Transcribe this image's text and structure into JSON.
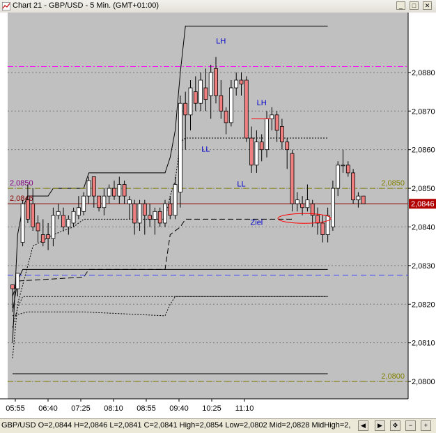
{
  "window": {
    "title": "Chart 21 - GBP/USD - 5 Min. (GMT+01:00)",
    "buttons": [
      "minimize",
      "maximize",
      "close"
    ]
  },
  "status": {
    "text": "GBP/USD O=2,0844 H=2,0846 L=2,0841 C=2,0841   High=2,0854 Low=2,0802 Mid=2,0828 MidHigh=2,"
  },
  "chart_data": {
    "type": "candlestick",
    "instrument": "GBP/USD",
    "timeframe": "5 Min.",
    "ylim": [
      2.07955,
      2.08955
    ],
    "yticks": [
      "2,0880",
      "2,0870",
      "2,0860",
      "2,0850",
      "2,0840",
      "2,0830",
      "2,0820",
      "2,0810",
      "2,0800"
    ],
    "xticks": [
      "05:55",
      "06:40",
      "07:25",
      "08:10",
      "08:55",
      "09:40",
      "10:25",
      "11:10"
    ],
    "candles": [
      {
        "o": 2.0825,
        "h": 2.0822,
        "l": 2.0819,
        "c": 2.0824
      },
      {
        "o": 2.0824,
        "h": 2.0828,
        "l": 2.0822,
        "c": 2.0828
      },
      {
        "o": 2.0836,
        "h": 2.0847,
        "l": 2.0835,
        "c": 2.0846
      },
      {
        "o": 2.0847,
        "h": 2.0851,
        "l": 2.0841,
        "c": 2.0842
      },
      {
        "o": 2.0846,
        "h": 2.085,
        "l": 2.0839,
        "c": 2.084
      },
      {
        "o": 2.0841,
        "h": 2.0843,
        "l": 2.0836,
        "c": 2.0839
      },
      {
        "o": 2.0838,
        "h": 2.0842,
        "l": 2.0835,
        "c": 2.0836
      },
      {
        "o": 2.0838,
        "h": 2.0841,
        "l": 2.0834,
        "c": 2.0837
      },
      {
        "o": 2.0837,
        "h": 2.0845,
        "l": 2.0835,
        "c": 2.0843
      },
      {
        "o": 2.0843,
        "h": 2.0846,
        "l": 2.0842,
        "c": 2.0844
      },
      {
        "o": 2.0843,
        "h": 2.0845,
        "l": 2.0839,
        "c": 2.084
      },
      {
        "o": 2.084,
        "h": 2.0843,
        "l": 2.0838,
        "c": 2.0842
      },
      {
        "o": 2.0841,
        "h": 2.0845,
        "l": 2.084,
        "c": 2.0844
      },
      {
        "o": 2.0843,
        "h": 2.0848,
        "l": 2.0842,
        "c": 2.0845
      },
      {
        "o": 2.0844,
        "h": 2.0849,
        "l": 2.0843,
        "c": 2.0848
      },
      {
        "o": 2.0848,
        "h": 2.0853,
        "l": 2.0846,
        "c": 2.0852
      },
      {
        "o": 2.0853,
        "h": 2.0853,
        "l": 2.0845,
        "c": 2.0848
      },
      {
        "o": 2.0848,
        "h": 2.0848,
        "l": 2.0844,
        "c": 2.0845
      },
      {
        "o": 2.0845,
        "h": 2.085,
        "l": 2.0843,
        "c": 2.0848
      },
      {
        "o": 2.0848,
        "h": 2.0851,
        "l": 2.0846,
        "c": 2.085
      },
      {
        "o": 2.085,
        "h": 2.0852,
        "l": 2.0847,
        "c": 2.0848
      },
      {
        "o": 2.0848,
        "h": 2.0853,
        "l": 2.0846,
        "c": 2.0851
      },
      {
        "o": 2.0851,
        "h": 2.0852,
        "l": 2.0846,
        "c": 2.0848
      },
      {
        "o": 2.0846,
        "h": 2.0848,
        "l": 2.0842,
        "c": 2.0847
      },
      {
        "o": 2.0846,
        "h": 2.0847,
        "l": 2.0838,
        "c": 2.0841
      },
      {
        "o": 2.0841,
        "h": 2.0847,
        "l": 2.0839,
        "c": 2.0846
      },
      {
        "o": 2.0846,
        "h": 2.0847,
        "l": 2.0838,
        "c": 2.0843
      },
      {
        "o": 2.0843,
        "h": 2.0846,
        "l": 2.084,
        "c": 2.0842
      },
      {
        "o": 2.0842,
        "h": 2.0845,
        "l": 2.0838,
        "c": 2.0844
      },
      {
        "o": 2.0844,
        "h": 2.0845,
        "l": 2.084,
        "c": 2.0841
      },
      {
        "o": 2.0841,
        "h": 2.0847,
        "l": 2.084,
        "c": 2.0846
      },
      {
        "o": 2.0846,
        "h": 2.0848,
        "l": 2.0842,
        "c": 2.0843
      },
      {
        "o": 2.0843,
        "h": 2.0853,
        "l": 2.0842,
        "c": 2.0851
      },
      {
        "o": 2.0849,
        "h": 2.0874,
        "l": 2.0845,
        "c": 2.0872
      },
      {
        "o": 2.0872,
        "h": 2.0875,
        "l": 2.086,
        "c": 2.0869
      },
      {
        "o": 2.0869,
        "h": 2.0878,
        "l": 2.0865,
        "c": 2.0876
      },
      {
        "o": 2.0875,
        "h": 2.0879,
        "l": 2.087,
        "c": 2.0872
      },
      {
        "o": 2.0872,
        "h": 2.088,
        "l": 2.087,
        "c": 2.0878
      },
      {
        "o": 2.0876,
        "h": 2.0881,
        "l": 2.087,
        "c": 2.0873
      },
      {
        "o": 2.0874,
        "h": 2.0882,
        "l": 2.0868,
        "c": 2.088
      },
      {
        "o": 2.0881,
        "h": 2.0884,
        "l": 2.0872,
        "c": 2.0874
      },
      {
        "o": 2.0874,
        "h": 2.0878,
        "l": 2.0868,
        "c": 2.087
      },
      {
        "o": 2.087,
        "h": 2.0871,
        "l": 2.0864,
        "c": 2.0867
      },
      {
        "o": 2.0867,
        "h": 2.0878,
        "l": 2.0866,
        "c": 2.0876
      },
      {
        "o": 2.0876,
        "h": 2.088,
        "l": 2.0874,
        "c": 2.0878
      },
      {
        "o": 2.0878,
        "h": 2.088,
        "l": 2.0874,
        "c": 2.0877
      },
      {
        "o": 2.0878,
        "h": 2.0879,
        "l": 2.0862,
        "c": 2.0863
      },
      {
        "o": 2.0863,
        "h": 2.0866,
        "l": 2.0854,
        "c": 2.0856
      },
      {
        "o": 2.0856,
        "h": 2.0865,
        "l": 2.0854,
        "c": 2.0862
      },
      {
        "o": 2.0862,
        "h": 2.0864,
        "l": 2.0857,
        "c": 2.086
      },
      {
        "o": 2.086,
        "h": 2.087,
        "l": 2.0858,
        "c": 2.0868
      },
      {
        "o": 2.0868,
        "h": 2.0871,
        "l": 2.0865,
        "c": 2.0869
      },
      {
        "o": 2.0869,
        "h": 2.087,
        "l": 2.0862,
        "c": 2.0865
      },
      {
        "o": 2.0866,
        "h": 2.0868,
        "l": 2.086,
        "c": 2.0862
      },
      {
        "o": 2.0862,
        "h": 2.0863,
        "l": 2.0855,
        "c": 2.086
      },
      {
        "o": 2.0859,
        "h": 2.086,
        "l": 2.0844,
        "c": 2.0846
      },
      {
        "o": 2.0846,
        "h": 2.0849,
        "l": 2.0844,
        "c": 2.0847
      },
      {
        "o": 2.0846,
        "h": 2.0848,
        "l": 2.0843,
        "c": 2.0845
      },
      {
        "o": 2.0845,
        "h": 2.0851,
        "l": 2.0844,
        "c": 2.0847
      },
      {
        "o": 2.0846,
        "h": 2.0847,
        "l": 2.084,
        "c": 2.0843
      },
      {
        "o": 2.0843,
        "h": 2.0845,
        "l": 2.0838,
        "c": 2.0841
      },
      {
        "o": 2.0841,
        "h": 2.0843,
        "l": 2.0836,
        "c": 2.0838
      },
      {
        "o": 2.0838,
        "h": 2.0845,
        "l": 2.0836,
        "c": 2.0843
      },
      {
        "o": 2.084,
        "h": 2.0852,
        "l": 2.0839,
        "c": 2.085
      },
      {
        "o": 2.085,
        "h": 2.0857,
        "l": 2.0848,
        "c": 2.0856
      },
      {
        "o": 2.0856,
        "h": 2.086,
        "l": 2.0854,
        "c": 2.0856
      },
      {
        "o": 2.0856,
        "h": 2.0857,
        "l": 2.0853,
        "c": 2.0854
      },
      {
        "o": 2.0854,
        "h": 2.0855,
        "l": 2.0846,
        "c": 2.0847
      },
      {
        "o": 2.0847,
        "h": 2.0849,
        "l": 2.0845,
        "c": 2.0848
      },
      {
        "o": 2.0848,
        "h": 2.0848,
        "l": 2.0846,
        "c": 2.0846
      }
    ],
    "levels": [
      {
        "kind": "hline",
        "value": 2.08815,
        "color": "#ff00ff",
        "style": "dashdot"
      },
      {
        "kind": "hline",
        "value": 2.08275,
        "color": "#4040ff",
        "style": "dashed"
      },
      {
        "kind": "hline",
        "value": 2.085,
        "color": "#808000",
        "style": "dashed",
        "label_left": "2,0850",
        "label_right": "2,0850"
      },
      {
        "kind": "hline",
        "value": 2.08,
        "color": "#808000",
        "style": "dashed",
        "label_right": "2,0800"
      },
      {
        "kind": "hline",
        "value": 2.0846,
        "color": "#8b0000",
        "style": "solid",
        "label_left": "2,0846",
        "current_price_label": "2,0846"
      }
    ],
    "annotations": [
      {
        "text": "LH",
        "x_index": 41,
        "y": 2.08875,
        "color": "#0000cc"
      },
      {
        "text": "LH",
        "x_index": 49,
        "y": 2.08715,
        "color": "#0000cc"
      },
      {
        "text": "LL",
        "x_index": 38,
        "y": 2.08595,
        "color": "#0000cc"
      },
      {
        "text": "LL",
        "x_index": 45,
        "y": 2.08505,
        "color": "#0000cc"
      },
      {
        "text": "Ziel",
        "x_index": 48,
        "y": 2.08405,
        "color": "#0000cc"
      }
    ],
    "envelope_lines": [
      {
        "style": "solid",
        "points": [
          [
            0,
            2.081
          ],
          [
            1,
            2.0838
          ],
          [
            2,
            2.0845
          ],
          [
            3,
            2.0848
          ],
          [
            7,
            2.0848
          ],
          [
            8,
            2.085
          ],
          [
            14,
            2.085
          ],
          [
            15,
            2.0854
          ],
          [
            30,
            2.0854
          ],
          [
            31,
            2.0858
          ],
          [
            32,
            2.0865
          ],
          [
            33,
            2.088
          ],
          [
            34,
            2.0892
          ],
          [
            62,
            2.0892
          ]
        ]
      },
      {
        "style": "solid",
        "points": [
          [
            0,
            2.0818
          ],
          [
            1,
            2.0826
          ],
          [
            2,
            2.0829
          ],
          [
            5,
            2.0829
          ],
          [
            9,
            2.0829
          ],
          [
            14,
            2.0829
          ],
          [
            15,
            2.0829
          ],
          [
            30,
            2.0829
          ],
          [
            31,
            2.0829
          ],
          [
            62,
            2.0829
          ]
        ]
      },
      {
        "style": "solid",
        "points": [
          [
            0,
            2.0802
          ],
          [
            62,
            2.0802
          ]
        ]
      },
      {
        "style": "dotted",
        "points": [
          [
            0,
            2.0806
          ],
          [
            1,
            2.082
          ],
          [
            3,
            2.083
          ],
          [
            4,
            2.0835
          ],
          [
            8,
            2.0838
          ],
          [
            12,
            2.084
          ],
          [
            14,
            2.0842
          ],
          [
            15,
            2.0842
          ],
          [
            30,
            2.0842
          ],
          [
            31,
            2.0848
          ],
          [
            32,
            2.0852
          ],
          [
            33,
            2.0862
          ],
          [
            34,
            2.0863
          ],
          [
            62,
            2.0863
          ]
        ]
      },
      {
        "style": "dotted",
        "points": [
          [
            0,
            2.0814
          ],
          [
            1,
            2.0819
          ],
          [
            2,
            2.0822
          ],
          [
            30,
            2.0822
          ],
          [
            31,
            2.0822
          ],
          [
            62,
            2.0822
          ]
        ]
      },
      {
        "style": "dotted",
        "points": [
          [
            0,
            2.0817
          ],
          [
            3,
            2.0818
          ],
          [
            13,
            2.0818
          ],
          [
            14,
            2.0818
          ],
          [
            30,
            2.0817
          ],
          [
            31,
            2.082
          ],
          [
            32,
            2.0822
          ],
          [
            62,
            2.0822
          ]
        ]
      },
      {
        "style": "dashed",
        "points": [
          [
            0,
            2.0822
          ],
          [
            1,
            2.0826
          ],
          [
            14,
            2.0827
          ],
          [
            15,
            2.0829
          ],
          [
            30,
            2.0829
          ],
          [
            31,
            2.0838
          ],
          [
            33,
            2.084
          ],
          [
            34,
            2.0842
          ],
          [
            55,
            2.0842
          ]
        ]
      }
    ],
    "ellipse": {
      "x_index": 57,
      "y": 2.08422,
      "color": "#ff0000"
    },
    "short_marker": {
      "x_from": 47,
      "x_to": 50,
      "y": 2.0868,
      "color": "#ff0000"
    },
    "grid": true,
    "colors": {
      "bg": "#c0c0c0",
      "up": "#ffffff",
      "down": "#f08080",
      "text": "#000000"
    }
  }
}
